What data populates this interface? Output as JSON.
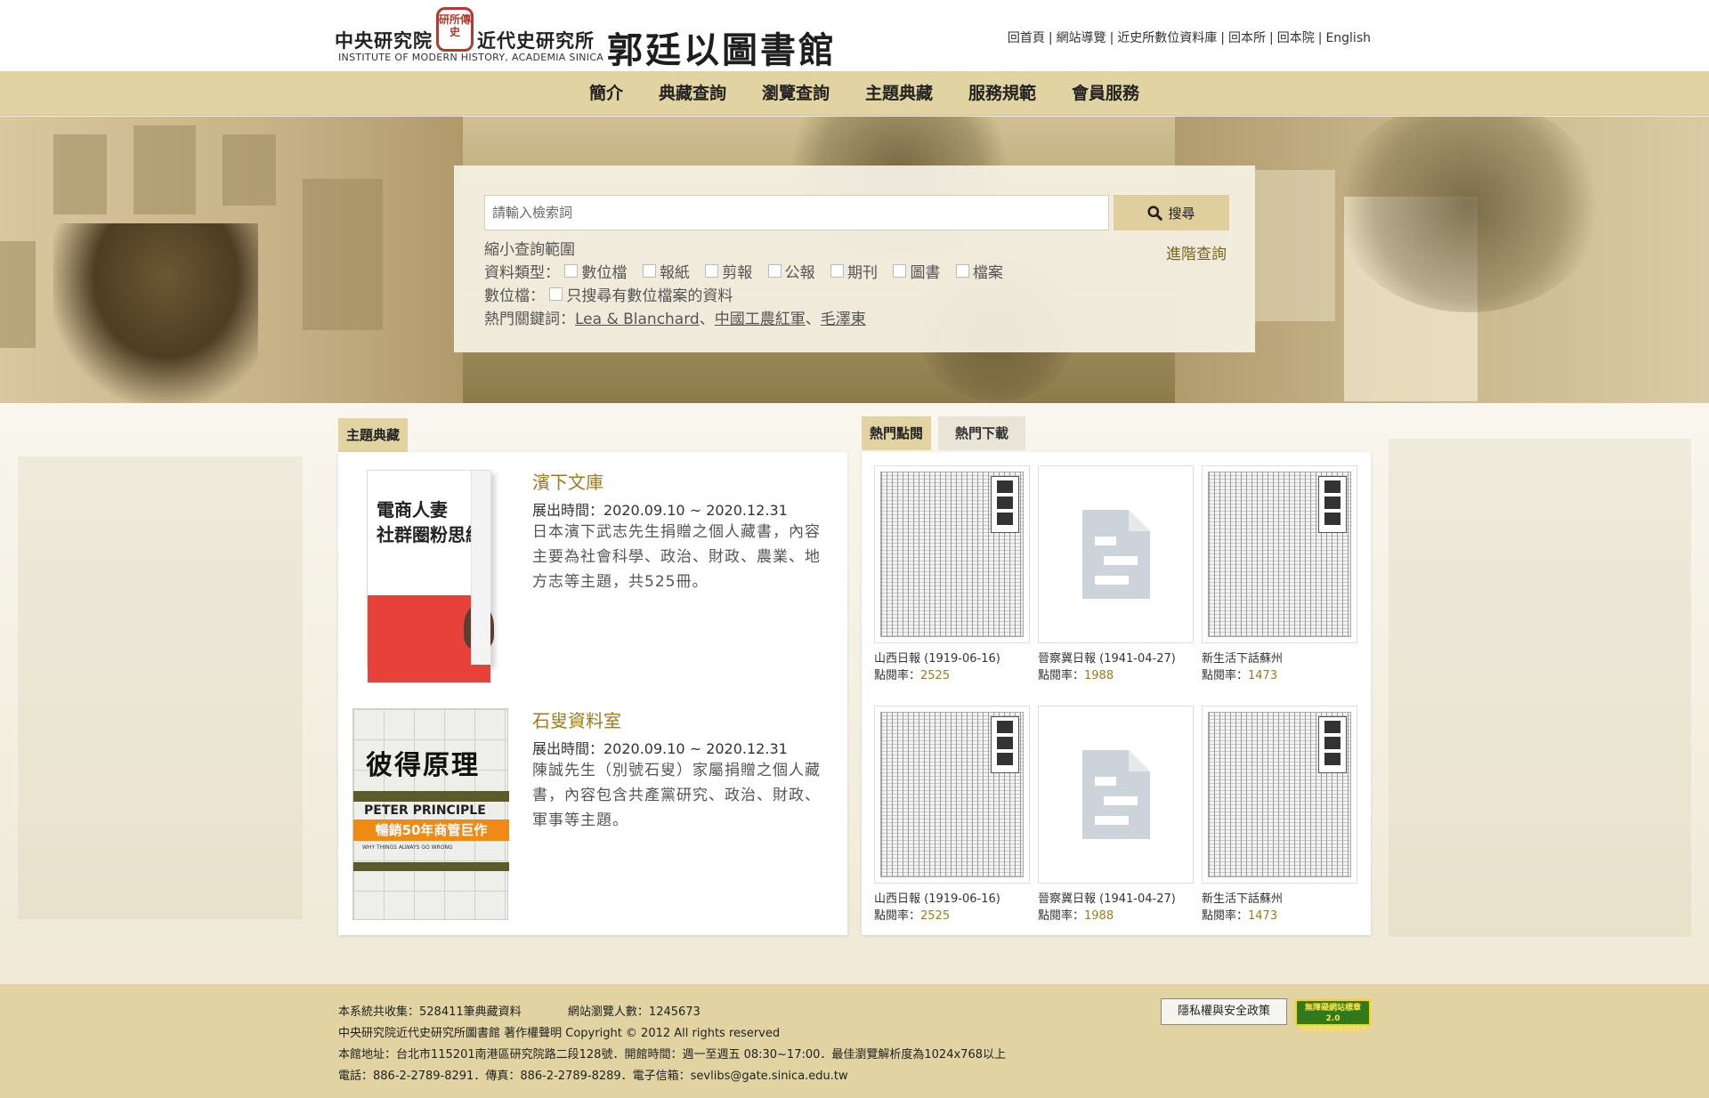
{
  "header": {
    "institute_name_1": "中央研究院",
    "seal_text": "研所傳史",
    "institute_name_2": "近代史研究所",
    "institute_en": "INSTITUTE OF MODERN HISTORY, ACADEMIA SINICA",
    "library_name": "郭廷以圖書館",
    "top_links": [
      "回首頁",
      "網站導覽",
      "近史所數位資料庫",
      "回本所",
      "回本院",
      "English"
    ]
  },
  "nav": {
    "items": [
      "簡介",
      "典藏查詢",
      "瀏覽查詢",
      "主題典藏",
      "服務規範",
      "會員服務"
    ]
  },
  "search": {
    "placeholder": "請輸入檢索詞",
    "button_label": "搜尋",
    "advanced_label": "進階查詢",
    "narrow_title": "縮小查詢範圍",
    "type_label": "資料類型：",
    "types": [
      "數位檔",
      "報紙",
      "剪報",
      "公報",
      "期刊",
      "圖書",
      "檔案"
    ],
    "digital_label": "數位檔：",
    "digital_option": "只搜尋有數位檔案的資料",
    "hot_label": "熱門關鍵詞：",
    "hot_keywords": [
      "Lea & Blanchard",
      "中國工農紅軍",
      "毛澤東"
    ],
    "hot_sep": "、"
  },
  "collections": {
    "tab_label": "主題典藏",
    "items": [
      {
        "title": "濱下文庫",
        "date": "展出時間：2020.09.10 ~ 2020.12.31",
        "desc": "日本濱下武志先生捐贈之個人藏書，內容主要為社會科學、政治、財政、農業、地方志等主題，共525冊。",
        "cover_lines": [
          "電商人妻",
          "社群圈粉思維"
        ]
      },
      {
        "title": "石叟資料室",
        "date": "展出時間：2020.09.10 ~ 2020.12.31",
        "desc": "陳誠先生（別號石叟）家屬捐贈之個人藏書，內容包含共產黨研究、政治、財政、軍事等主題。",
        "cover_title": "彼得原理",
        "cover_subtitle": "PETER PRINCIPLE",
        "cover_banner": "暢銷50年商管巨作",
        "cover_small": "WHY THINGS ALWAYS GO WRONG"
      }
    ]
  },
  "popular": {
    "tabs": [
      "熱門點閱",
      "熱門下載"
    ],
    "rate_label": "點閱率：",
    "items": [
      {
        "caption": "山西日報 (1919-06-16)",
        "rate": "2525",
        "thumb": "newspaper"
      },
      {
        "caption": "晉察冀日報 (1941-04-27)",
        "rate": "1988",
        "thumb": "document-icon"
      },
      {
        "caption": "新生活下話蘇州",
        "rate": "1473",
        "thumb": "newspaper"
      },
      {
        "caption": "山西日報 (1919-06-16)",
        "rate": "2525",
        "thumb": "newspaper"
      },
      {
        "caption": "晉察冀日報 (1941-04-27)",
        "rate": "1988",
        "thumb": "document-icon"
      },
      {
        "caption": "新生活下話蘇州",
        "rate": "1473",
        "thumb": "newspaper"
      }
    ]
  },
  "footer": {
    "line1a": "本系統共收集：528411筆典藏資料",
    "line1b": "網站瀏覽人數：1245673",
    "line2": "中央研究院近代史研究所圖書館 著作權聲明 Copyright © 2012 All rights reserved",
    "line3": "本館地址：台北市115201南港區研究院路二段128號．開館時間：週一至週五 08:30~17:00．最佳瀏覽解析度為1024x768以上",
    "line4": "電話：886-2-2789-8291．傳真：886-2-2789-8289．電子信箱：sevlibs@gate.sinica.edu.tw",
    "privacy_label": "隱私權與安全政策",
    "badge_text": "無障礙網站標章2.0 ACCESSIBILITY"
  },
  "colors": {
    "accent": "#e1d3a2",
    "link_gold": "#a07a1f",
    "footer_bg": "#e1d3a2"
  }
}
